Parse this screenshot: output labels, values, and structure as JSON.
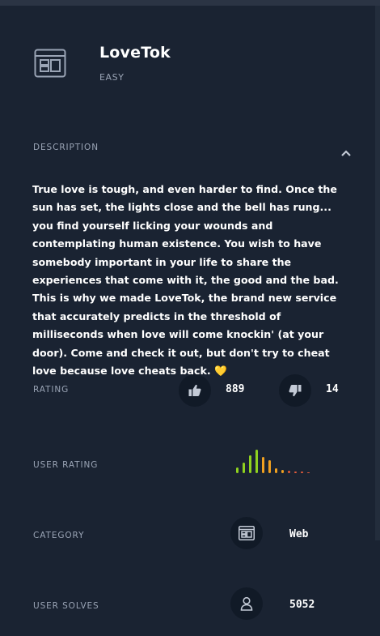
{
  "challenge": {
    "title": "LoveTok",
    "difficulty": "EASY"
  },
  "description": {
    "label": "DESCRIPTION",
    "text": "True love is tough, and even harder to find. Once the sun has set, the lights close and the bell has rung... you find yourself licking your wounds and contemplating human existence. You wish to have somebody important in your life to share the experiences that come with it, the good and the bad. This is why we made LoveTok, the brand new service that accurately predicts in the threshold of milliseconds when love will come knockin' (at your door). Come and check it out, but don't try to cheat love because love cheats back.",
    "emoji": "💛"
  },
  "rating": {
    "label": "RATING",
    "likes": "889",
    "dislikes": "14"
  },
  "user_rating": {
    "label": "USER RATING",
    "distribution": [
      0.22,
      0.42,
      0.7,
      0.92,
      0.62,
      0.5,
      0.18,
      0.12,
      0.08,
      0.06,
      0.05,
      0.04
    ],
    "colors": [
      "#8fd11f",
      "#8fd11f",
      "#8fd11f",
      "#8fd11f",
      "#f0a020",
      "#f0a020",
      "#f0a020",
      "#f0a020",
      "#e05a3a",
      "#e05a3a",
      "#e05a3a",
      "#e05a3a"
    ]
  },
  "category": {
    "label": "CATEGORY",
    "value": "Web",
    "icon": "web-window-icon"
  },
  "user_solves": {
    "label": "USER SOLVES",
    "value": "5052",
    "icon": "user-icon"
  },
  "colors": {
    "background": "#1a2332",
    "circle": "#111a27",
    "muted": "#9aa4b5"
  }
}
